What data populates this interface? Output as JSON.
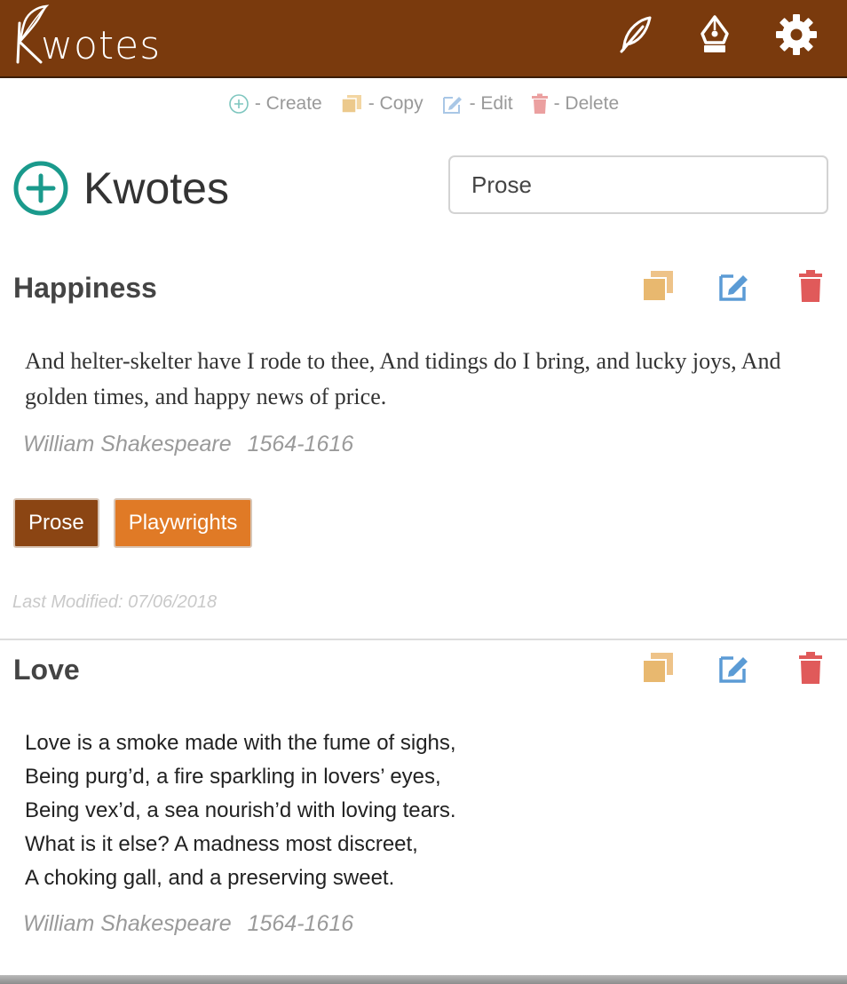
{
  "app": {
    "title": "Kwotes"
  },
  "header": {
    "logo_text": "wotes",
    "icons": [
      "feather-icon",
      "pen-nib-icon",
      "gear-icon"
    ]
  },
  "legend": {
    "create": "- Create",
    "copy": "- Copy",
    "edit": "- Edit",
    "delete": "- Delete"
  },
  "main": {
    "title": "Kwotes",
    "search_value": "Prose"
  },
  "colors": {
    "header_bg": "#7a3a0d",
    "teal": "#1a9a8c",
    "copy": "#e8b86f",
    "edit": "#5b9bd5",
    "delete": "#e05a5a",
    "tag_prose": "#8b4513",
    "tag_playwrights": "#e07a26"
  },
  "quotes": [
    {
      "title": "Happiness",
      "text": "And helter-skelter have I rode to thee, And tidings do I bring, and lucky joys, And golden times, and happy news of price.",
      "author": "William Shakespeare",
      "years": "1564-1616",
      "tags": [
        "Prose",
        "Playwrights"
      ],
      "modified": "Last Modified: 07/06/2018"
    },
    {
      "title": "Love",
      "lines": [
        "Love is a smoke made with the fume of sighs,",
        "Being purg’d, a fire sparkling in lovers’ eyes,",
        "Being vex’d, a sea nourish’d with loving tears.",
        "What is it else? A madness most discreet,",
        "A choking gall, and a preserving sweet."
      ],
      "author": "William Shakespeare",
      "years": "1564-1616"
    }
  ]
}
